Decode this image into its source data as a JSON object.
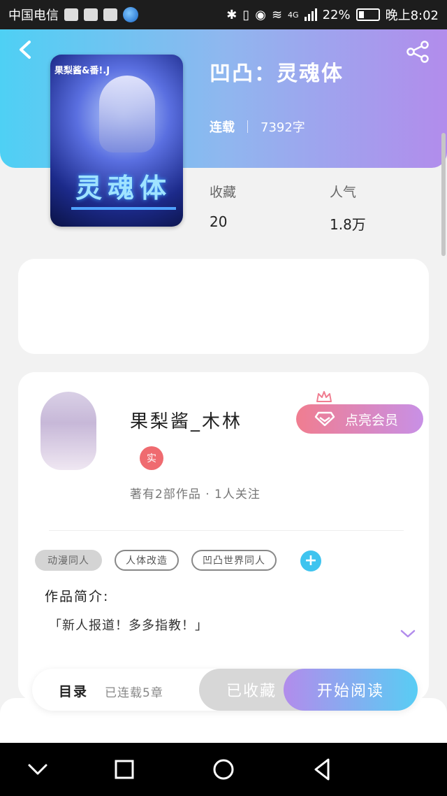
{
  "status_bar": {
    "carrier": "中国电信",
    "battery": "22%",
    "network": "4G",
    "time": "晚上8:02"
  },
  "book": {
    "title": "凹凸：灵魂体",
    "status": "连载",
    "word_count": "7392字",
    "cover_text_top": "果梨酱&番!.J",
    "cover_text_title": "灵魂体",
    "stats": [
      {
        "label": "收藏",
        "value": "20"
      },
      {
        "label": "人气",
        "value": "1.8万"
      }
    ]
  },
  "author": {
    "name": "果梨酱_木林",
    "badge": "实",
    "works_info": "著有2部作品 · 1人关注",
    "vip_button": "点亮会员"
  },
  "tags": [
    "动漫同人",
    "人体改造",
    "凹凸世界同人"
  ],
  "add_tag_symbol": "+",
  "intro": {
    "heading": "作品简介:",
    "text": "「新人报道！多多指教！」"
  },
  "action_bar": {
    "toc_label": "目录",
    "toc_count": "已连载5章",
    "fav_button": "已收藏",
    "read_button": "开始阅读"
  },
  "icons": {
    "back": "chevron-left-icon",
    "share": "share-icon",
    "expand": "chevron-down-icon",
    "vip": "diamond-icon"
  },
  "colors": {
    "header_gradient_start": "#4ed0f4",
    "header_gradient_end": "#b28cec",
    "vip_gradient_start": "#f07d90",
    "vip_gradient_end": "#c890e6",
    "accent_blue": "#3fc4ef",
    "badge_red": "#ef6b70",
    "expand_purple": "#b28cec"
  }
}
